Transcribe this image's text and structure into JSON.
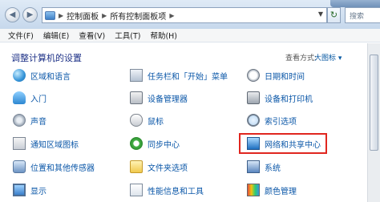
{
  "address": {
    "breadcrumb": [
      "控制面板",
      "所有控制面板项"
    ],
    "search_placeholder": "搜索"
  },
  "menu": [
    "文件(F)",
    "编辑(E)",
    "查看(V)",
    "工具(T)",
    "帮助(H)"
  ],
  "heading": "调整计算机的设置",
  "view": {
    "label": "查看方式:",
    "value": "大图标 ▾"
  },
  "items": {
    "col1": [
      {
        "label": "区域和语言",
        "icon": "globe-icon"
      },
      {
        "label": "入门",
        "icon": "people-icon"
      },
      {
        "label": "声音",
        "icon": "speaker-icon"
      },
      {
        "label": "通知区域图标",
        "icon": "tray-icon"
      },
      {
        "label": "位置和其他传感器",
        "icon": "sensor-icon"
      },
      {
        "label": "显示",
        "icon": "monitor-icon"
      }
    ],
    "col2": [
      {
        "label": "任务栏和「开始」菜单",
        "icon": "taskbar-icon"
      },
      {
        "label": "设备管理器",
        "icon": "device-manager-icon"
      },
      {
        "label": "鼠标",
        "icon": "mouse-icon"
      },
      {
        "label": "同步中心",
        "icon": "sync-icon"
      },
      {
        "label": "文件夹选项",
        "icon": "folder-icon"
      },
      {
        "label": "性能信息和工具",
        "icon": "performance-icon"
      }
    ],
    "col3": [
      {
        "label": "日期和时间",
        "icon": "clock-icon"
      },
      {
        "label": "设备和打印机",
        "icon": "printer-icon"
      },
      {
        "label": "索引选项",
        "icon": "search-index-icon"
      },
      {
        "label": "网络和共享中心",
        "icon": "network-icon"
      },
      {
        "label": "系统",
        "icon": "system-icon"
      },
      {
        "label": "颜色管理",
        "icon": "color-icon"
      }
    ]
  }
}
